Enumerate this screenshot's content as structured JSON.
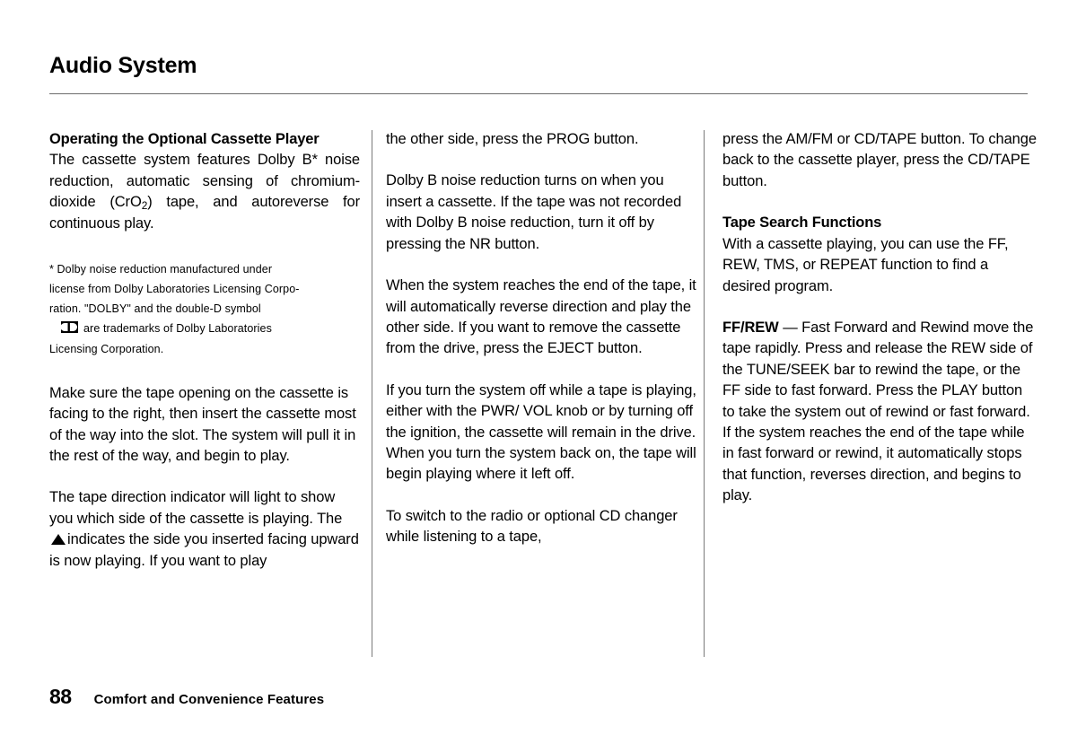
{
  "header": {
    "title": "Audio System"
  },
  "columns": {
    "col1": {
      "heading": "Operating the Optional Cassette Player",
      "para1_a": "The cassette system features Dolby B* noise reduction, automatic sensing of chromium-dioxide (CrO",
      "para1_sub": "2",
      "para1_b": ") tape, and autoreverse for continuous play.",
      "footnote": {
        "line1": "* Dolby noise reduction manufactured under",
        "line2": "license from Dolby Laboratories Licensing Corpo-",
        "line3": "ration. \"DOLBY\" and the double-D symbol",
        "line4_icon": "dolby-double-d-icon",
        "line4": "are trademarks of Dolby Laboratories",
        "line5": "Licensing Corporation."
      },
      "para2": "Make sure the tape opening on the cassette is facing to the right, then insert the cassette most of the way into the slot. The system will pull it in the rest of the way, and begin to play.",
      "para3_a": "The tape direction indicator will light to show you which side of the cassette is playing. The",
      "para3_icon": "up-triangle-icon",
      "para3_b": "indicates the side you inserted facing upward is now playing. If you want to play"
    },
    "col2": {
      "para1": "the other side, press the PROG button.",
      "para2": "Dolby B noise reduction turns on when you insert a cassette. If the tape was not recorded with Dolby B noise reduction, turn it off by pressing the NR button.",
      "para3": "When the system reaches the end of the tape, it will automatically reverse direction and play the other side. If you want to remove the cassette from the drive, press the EJECT button.",
      "para4": "If you turn the system off while a tape is playing, either with the PWR/ VOL knob or by turning off the ignition, the cassette will remain in the drive. When you turn the system back on, the tape will begin playing where it left off.",
      "para5": "To switch to the radio or optional CD changer while listening to a tape,"
    },
    "col3": {
      "para1": "press the AM/FM or CD/TAPE button. To change back to the cassette player, press the CD/TAPE button.",
      "heading": "Tape Search Functions",
      "para2": "With a cassette playing, you can use the FF, REW, TMS, or REPEAT function to find a desired program.",
      "para3_bold": "FF/REW",
      "para3_dash": "—",
      "para3": "Fast Forward and Rewind move the tape rapidly. Press and release the REW side of the TUNE/SEEK bar to rewind the tape, or the FF side to fast forward. Press the PLAY button to take the system out of rewind or fast forward. If the system reaches the end of the tape while in fast forward or rewind, it automatically stops that function, reverses direction, and begins to play."
    }
  },
  "footer": {
    "page_number": "88",
    "section": "Comfort and Convenience Features"
  },
  "colors": {
    "text": "#000000",
    "rule": "#6d6d6d",
    "background": "#ffffff"
  }
}
